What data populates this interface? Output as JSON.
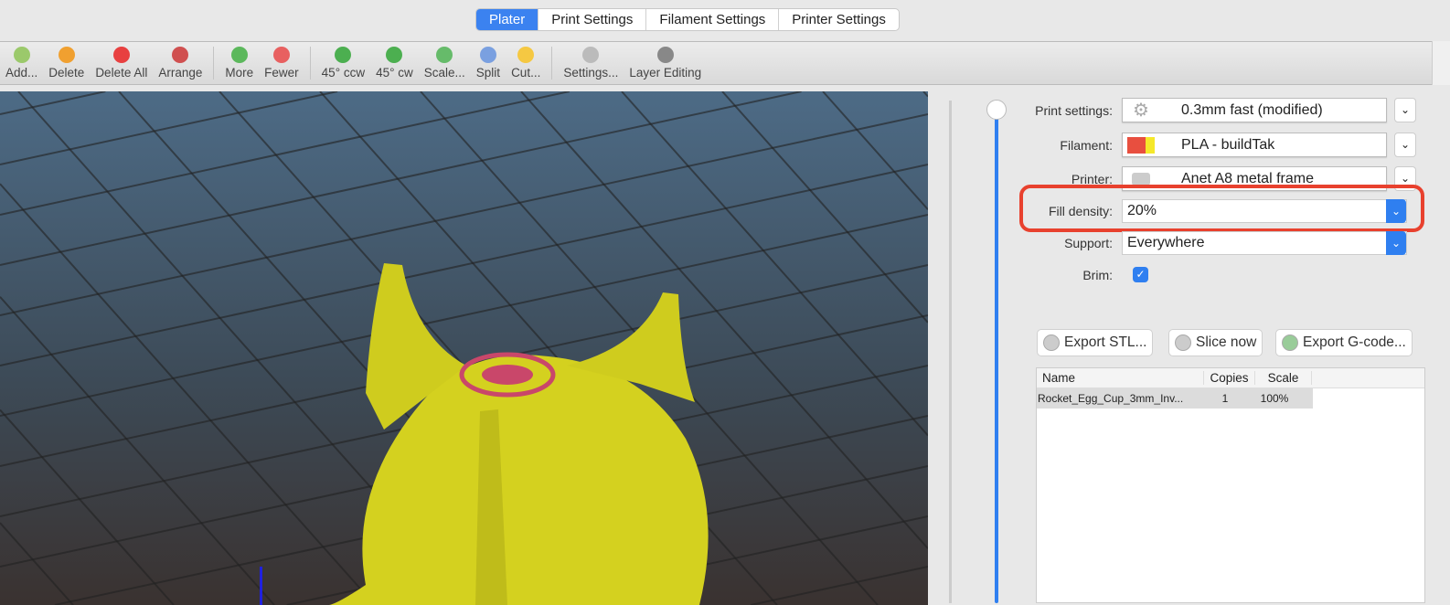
{
  "tabs": [
    "Plater",
    "Print Settings",
    "Filament Settings",
    "Printer Settings"
  ],
  "toolbar": [
    {
      "label": "Add...",
      "icon": "add-icon",
      "color": "#9bc96b"
    },
    {
      "label": "Delete",
      "icon": "delete-icon",
      "color": "#f0a030"
    },
    {
      "label": "Delete All",
      "icon": "delete-all-icon",
      "color": "#e84040"
    },
    {
      "label": "Arrange",
      "icon": "arrange-icon",
      "color": "#d05050"
    },
    {
      "label": "More",
      "icon": "more-icon",
      "color": "#5cb85c"
    },
    {
      "label": "Fewer",
      "icon": "fewer-icon",
      "color": "#e86060"
    },
    {
      "label": "45° ccw",
      "icon": "rotate-ccw-icon",
      "color": "#4caf50"
    },
    {
      "label": "45° cw",
      "icon": "rotate-cw-icon",
      "color": "#4caf50"
    },
    {
      "label": "Scale...",
      "icon": "scale-icon",
      "color": "#66bb6a"
    },
    {
      "label": "Split",
      "icon": "split-icon",
      "color": "#7aa0e0"
    },
    {
      "label": "Cut...",
      "icon": "cut-icon",
      "color": "#f5c842"
    },
    {
      "label": "Settings...",
      "icon": "gear-icon",
      "color": "#bbbbbb"
    },
    {
      "label": "Layer Editing",
      "icon": "layers-icon",
      "color": "#888888"
    }
  ],
  "panel": {
    "print_settings_label": "Print settings:",
    "print_settings_value": "0.3mm fast (modified)",
    "filament_label": "Filament:",
    "filament_value": "PLA - buildTak",
    "printer_label": "Printer:",
    "printer_value": "Anet A8 metal frame",
    "fill_label": "Fill density:",
    "fill_value": "20%",
    "support_label": "Support:",
    "support_value": "Everywhere",
    "brim_label": "Brim:",
    "brim_checked": true,
    "export_stl": "Export STL...",
    "slice_now": "Slice now",
    "export_gcode": "Export G-code..."
  },
  "objects": {
    "columns": [
      "Name",
      "Copies",
      "Scale"
    ],
    "rows": [
      {
        "name": "Rocket_Egg_Cup_3mm_Inv...",
        "copies": "1",
        "scale": "100%"
      }
    ]
  },
  "colors": {
    "accent": "#2f7ff0",
    "highlight": "#e8412e",
    "model": "#d9d622"
  }
}
